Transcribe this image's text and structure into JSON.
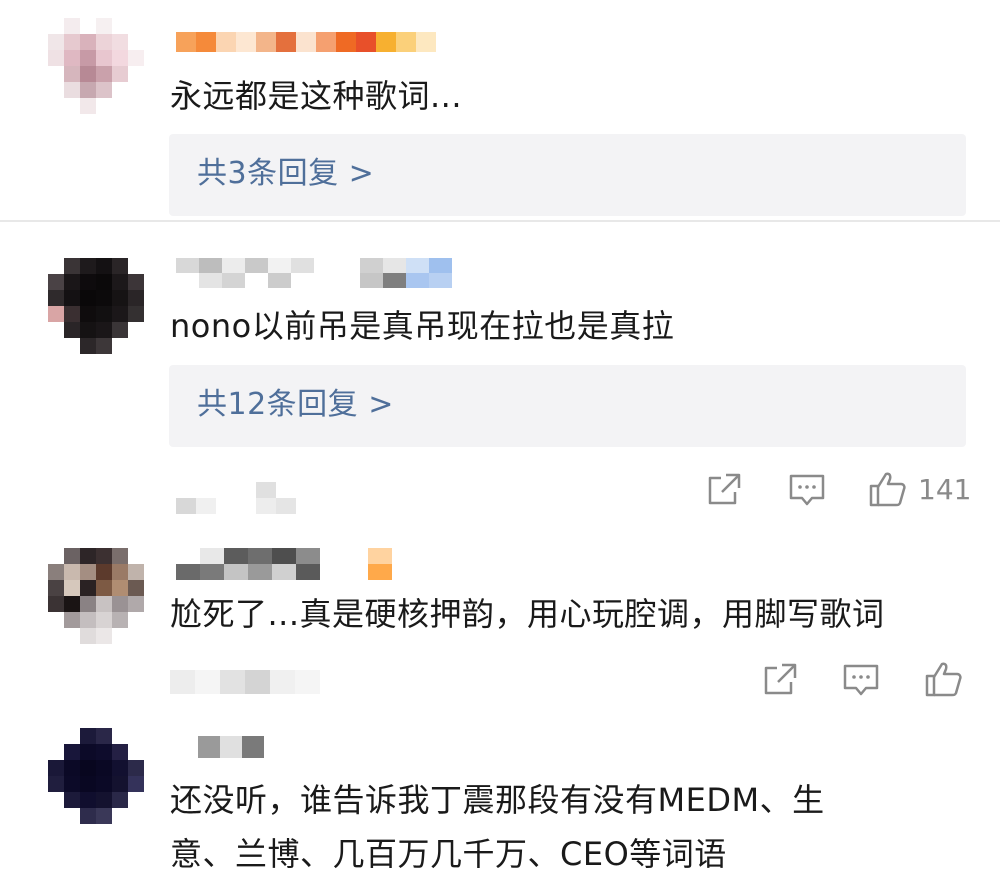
{
  "comments": [
    {
      "text": "永远都是这种歌词...",
      "reply_link": "共3条回复 >"
    },
    {
      "text": "nono以前吊是真吊现在拉也是真拉",
      "reply_link": "共12条回复 >",
      "like_count": "141"
    },
    {
      "text": "尬死了...真是硬核押韵，用心玩腔调，用脚写歌词"
    },
    {
      "text_line1": "还没听，谁告诉我丁震那段有没有MEDM、生",
      "text_line2": "意、兰博、几百万几千万、CEO等词语"
    }
  ],
  "colors": {
    "reply_link": "#4f6f9a",
    "reply_bg": "#f3f3f5",
    "icon": "#8a8a8a",
    "like_count": "#8a8a8a"
  },
  "icons": {
    "share": "share-icon",
    "comment": "comment-icon",
    "like": "thumbs-up-icon"
  }
}
